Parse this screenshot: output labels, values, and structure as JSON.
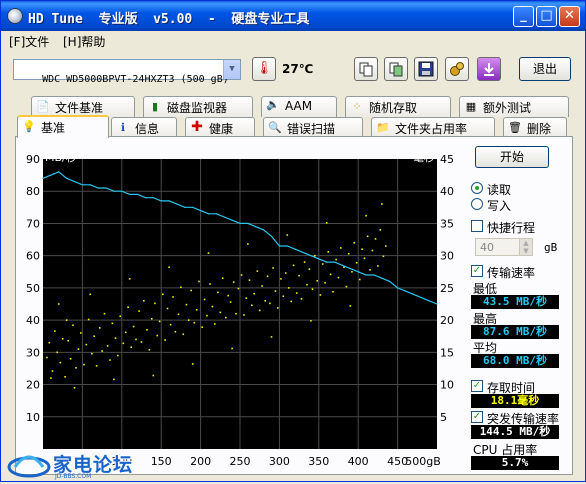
{
  "window": {
    "title": "HD Tune  专业版  v5.00  -  硬盘专业工具",
    "minimize": "_",
    "maximize": "□",
    "close": "✕"
  },
  "menu": [
    {
      "label": "[F]文件"
    },
    {
      "label": "[H]帮助"
    }
  ],
  "toolbar": {
    "drive": "WDC WD5000BPVT-24HXZT3 (500 gB)",
    "temperature": "27℃",
    "exit_label": "退出"
  },
  "tabs_top": [
    {
      "label": "文件基准",
      "icon": "document-icon"
    },
    {
      "label": "磁盘监视器",
      "icon": "bar-chart-icon"
    },
    {
      "label": "AAM",
      "icon": "speaker-icon"
    },
    {
      "label": "随机存取",
      "icon": "scatter-icon"
    },
    {
      "label": "额外测试",
      "icon": "grid-icon"
    }
  ],
  "tabs_bottom": [
    {
      "label": "基准",
      "icon": "bulb-icon",
      "active": true
    },
    {
      "label": "信息",
      "icon": "info-icon"
    },
    {
      "label": "健康",
      "icon": "health-cross-icon"
    },
    {
      "label": "错误扫描",
      "icon": "magnifier-icon"
    },
    {
      "label": "文件夹占用率",
      "icon": "folder-icon"
    },
    {
      "label": "删除",
      "icon": "trash-icon"
    }
  ],
  "side": {
    "start_label": "开始",
    "read_label": "读取",
    "write_label": "写入",
    "mode": "read",
    "quick_label": "快捷行程",
    "quick_checked": false,
    "quick_value": "40",
    "quick_unit": "gB",
    "transfer_label": "传输速率",
    "transfer_checked": true,
    "min_label": "最低",
    "min_value": "43.5 MB/秒",
    "max_label": "最高",
    "max_value": "87.6 MB/秒",
    "avg_label": "平均",
    "avg_value": "68.0 MB/秒",
    "access_label": "存取时间",
    "access_checked": true,
    "access_value": "18.1毫秒",
    "burst_label": "突发传输速率",
    "burst_checked": true,
    "burst_value": "144.5 MB/秒",
    "cpu_label": "CPU 占用率",
    "cpu_value": "5.7%"
  },
  "watermark": {
    "text": "家电论坛",
    "sub": "JD-BBS.COM"
  },
  "chart_data": {
    "type": "line",
    "title": "",
    "ylabel_left": "MB/秒",
    "ylabel_right": "毫秒",
    "xlabel": "gB",
    "x_ticks": [
      "50",
      "100",
      "150",
      "200",
      "250",
      "300",
      "350",
      "400",
      "450",
      "500gB"
    ],
    "y_left_ticks": [
      "90",
      "80",
      "70",
      "60",
      "50",
      "40",
      "30",
      "20",
      "10"
    ],
    "y_right_ticks": [
      "45",
      "40",
      "35",
      "30",
      "25",
      "20",
      "15",
      "10",
      "5"
    ],
    "xlim": [
      0,
      500
    ],
    "ylim_left": [
      0,
      90
    ],
    "ylim_right": [
      0,
      45
    ],
    "grid": true,
    "series": [
      {
        "name": "传输速率",
        "color": "#29c6ee",
        "x": [
          0,
          10,
          20,
          30,
          40,
          50,
          60,
          70,
          80,
          90,
          100,
          110,
          120,
          130,
          140,
          150,
          160,
          170,
          180,
          190,
          200,
          210,
          220,
          230,
          240,
          250,
          260,
          270,
          280,
          290,
          300,
          310,
          320,
          330,
          340,
          350,
          360,
          370,
          380,
          390,
          400,
          410,
          420,
          430,
          440,
          450,
          460,
          470,
          480,
          490,
          500
        ],
        "y": [
          84,
          85,
          86,
          84,
          83,
          82,
          82,
          81,
          81,
          80,
          80,
          79,
          79,
          78,
          78,
          77,
          77,
          76,
          75,
          75,
          74,
          73,
          73,
          72,
          71,
          70,
          70,
          69,
          68,
          66,
          63,
          63,
          62,
          61,
          60,
          59,
          58,
          58,
          57,
          56,
          55,
          54,
          54,
          53,
          52,
          50,
          49,
          48,
          47,
          46,
          45
        ]
      }
    ],
    "scatter": {
      "name": "存取时间",
      "color": "#f0f000",
      "unit": "毫秒",
      "points": [
        [
          5,
          14.2
        ],
        [
          8,
          16.5
        ],
        [
          12,
          12.1
        ],
        [
          15,
          18.3
        ],
        [
          18,
          15.0
        ],
        [
          22,
          13.4
        ],
        [
          25,
          17.1
        ],
        [
          28,
          11.2
        ],
        [
          32,
          16.8
        ],
        [
          35,
          14.0
        ],
        [
          38,
          19.2
        ],
        [
          42,
          12.6
        ],
        [
          45,
          15.5
        ],
        [
          48,
          18.0
        ],
        [
          52,
          13.1
        ],
        [
          55,
          16.2
        ],
        [
          58,
          20.1
        ],
        [
          62,
          14.8
        ],
        [
          65,
          17.5
        ],
        [
          68,
          12.9
        ],
        [
          72,
          18.8
        ],
        [
          75,
          15.2
        ],
        [
          78,
          21.0
        ],
        [
          82,
          16.0
        ],
        [
          85,
          13.8
        ],
        [
          88,
          19.5
        ],
        [
          92,
          17.2
        ],
        [
          95,
          14.5
        ],
        [
          98,
          20.6
        ],
        [
          102,
          16.4
        ],
        [
          105,
          18.1
        ],
        [
          108,
          22.0
        ],
        [
          112,
          15.8
        ],
        [
          115,
          19.0
        ],
        [
          118,
          17.0
        ],
        [
          122,
          21.4
        ],
        [
          125,
          16.6
        ],
        [
          128,
          23.0
        ],
        [
          132,
          18.5
        ],
        [
          135,
          15.4
        ],
        [
          138,
          20.2
        ],
        [
          142,
          22.6
        ],
        [
          145,
          17.6
        ],
        [
          148,
          19.8
        ],
        [
          152,
          24.0
        ],
        [
          155,
          16.9
        ],
        [
          158,
          21.8
        ],
        [
          162,
          19.3
        ],
        [
          165,
          23.6
        ],
        [
          168,
          18.2
        ],
        [
          172,
          20.9
        ],
        [
          175,
          25.1
        ],
        [
          178,
          17.8
        ],
        [
          182,
          22.4
        ],
        [
          185,
          20.0
        ],
        [
          188,
          24.6
        ],
        [
          192,
          19.6
        ],
        [
          195,
          21.6
        ],
        [
          198,
          26.0
        ],
        [
          202,
          18.9
        ],
        [
          205,
          23.2
        ],
        [
          208,
          20.7
        ],
        [
          212,
          25.6
        ],
        [
          215,
          22.1
        ],
        [
          218,
          19.4
        ],
        [
          222,
          24.3
        ],
        [
          225,
          21.2
        ],
        [
          228,
          26.5
        ],
        [
          232,
          20.4
        ],
        [
          235,
          23.8
        ],
        [
          238,
          22.8
        ],
        [
          242,
          25.9
        ],
        [
          245,
          21.0
        ],
        [
          248,
          24.9
        ],
        [
          252,
          27.0
        ],
        [
          255,
          20.8
        ],
        [
          258,
          23.4
        ],
        [
          262,
          26.2
        ],
        [
          265,
          22.3
        ],
        [
          268,
          24.1
        ],
        [
          272,
          27.6
        ],
        [
          275,
          21.5
        ],
        [
          278,
          25.3
        ],
        [
          282,
          23.0
        ],
        [
          285,
          26.8
        ],
        [
          288,
          22.6
        ],
        [
          292,
          28.1
        ],
        [
          295,
          24.5
        ],
        [
          298,
          21.9
        ],
        [
          302,
          26.4
        ],
        [
          305,
          23.7
        ],
        [
          308,
          27.3
        ],
        [
          312,
          25.0
        ],
        [
          315,
          22.9
        ],
        [
          318,
          28.5
        ],
        [
          322,
          24.2
        ],
        [
          325,
          26.9
        ],
        [
          328,
          23.3
        ],
        [
          332,
          29.0
        ],
        [
          335,
          25.5
        ],
        [
          338,
          27.9
        ],
        [
          342,
          24.8
        ],
        [
          345,
          30.0
        ],
        [
          348,
          26.1
        ],
        [
          352,
          23.9
        ],
        [
          355,
          28.7
        ],
        [
          358,
          25.8
        ],
        [
          362,
          30.6
        ],
        [
          365,
          27.1
        ],
        [
          368,
          24.4
        ],
        [
          372,
          29.4
        ],
        [
          375,
          26.6
        ],
        [
          378,
          31.2
        ],
        [
          382,
          28.2
        ],
        [
          385,
          25.2
        ],
        [
          388,
          30.3
        ],
        [
          392,
          27.5
        ],
        [
          395,
          32.0
        ],
        [
          398,
          28.9
        ],
        [
          402,
          26.3
        ],
        [
          405,
          31.0
        ],
        [
          408,
          29.6
        ],
        [
          412,
          33.0
        ],
        [
          415,
          27.8
        ],
        [
          418,
          30.8
        ],
        [
          422,
          32.6
        ],
        [
          425,
          28.4
        ],
        [
          428,
          34.0
        ],
        [
          432,
          29.9
        ],
        [
          435,
          31.5
        ],
        [
          40,
          9.5
        ],
        [
          90,
          10.8
        ],
        [
          140,
          11.4
        ],
        [
          190,
          13.2
        ],
        [
          240,
          15.6
        ],
        [
          290,
          17.4
        ],
        [
          340,
          19.9
        ],
        [
          390,
          22.2
        ],
        [
          20,
          22.5
        ],
        [
          60,
          24.0
        ],
        [
          110,
          26.4
        ],
        [
          160,
          28.2
        ],
        [
          210,
          30.4
        ],
        [
          260,
          31.8
        ],
        [
          310,
          33.2
        ],
        [
          360,
          35.1
        ],
        [
          410,
          36.2
        ],
        [
          430,
          38.0
        ],
        [
          10,
          11.0
        ],
        [
          30,
          20.0
        ]
      ]
    }
  }
}
